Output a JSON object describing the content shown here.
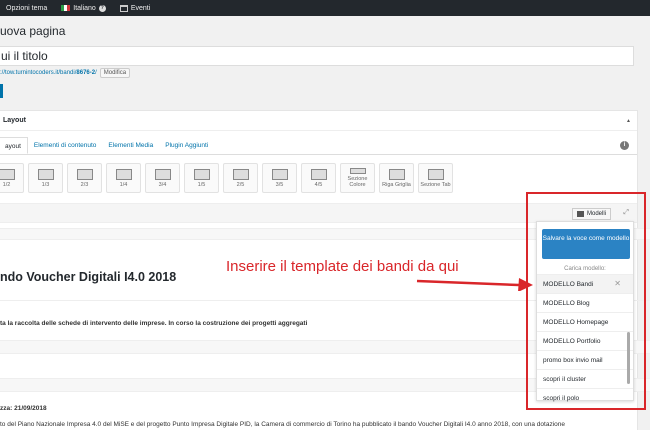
{
  "adminbar": {
    "theme_options": "Opzioni tema",
    "language": "Italiano",
    "events": "Eventi"
  },
  "page": {
    "title": "uova pagina",
    "title_input_value": "ui il titolo",
    "permalink_url": "://tow.turnintocoders.it/bandi/",
    "permalink_slug": "8676-2",
    "permalink_tail": "/",
    "edit_button": "Modifica"
  },
  "builder": {
    "panel_title": "Layout",
    "tabs": [
      "ayout",
      "Elementi di contenuto",
      "Elementi Media",
      "Plugin Aggiunti"
    ],
    "elements": [
      "1/2",
      "1/3",
      "2/3",
      "1/4",
      "3/4",
      "1/5",
      "2/5",
      "3/5",
      "4/5",
      "Sezione Colore",
      "Riga Griglia",
      "Sezione Tab"
    ],
    "modelli_button": "Modelli"
  },
  "content": {
    "heading": "ndo Voucher Digitali I4.0 2018",
    "subtext": "ta la raccolta delle schede di intervento delle imprese. In corso la costruzione dei progetti aggregati",
    "date_line": "zza: 21/09/2018",
    "body_line": "to del Piano Nazionale Impresa 4.0 del MiSE e del progetto Punto Impresa Digitale PID, la Camera di commercio di Torino ha pubblicato il bando Voucher Digitali I4.0 anno 2018, con una dotazione"
  },
  "annotation": {
    "text": "Inserire il template dei bandi da qui",
    "color": "#d9262a"
  },
  "dropdown": {
    "save_button": "Salvare la voce come modello",
    "load_label": "Carica modello:",
    "items": [
      "MODELLO Bandi",
      "MODELLO Blog",
      "MODELLO Homepage",
      "MODELLO Portfolio",
      "promo box invio mail",
      "scopri il cluster",
      "scopri il polo"
    ],
    "close_glyph": "✕"
  }
}
